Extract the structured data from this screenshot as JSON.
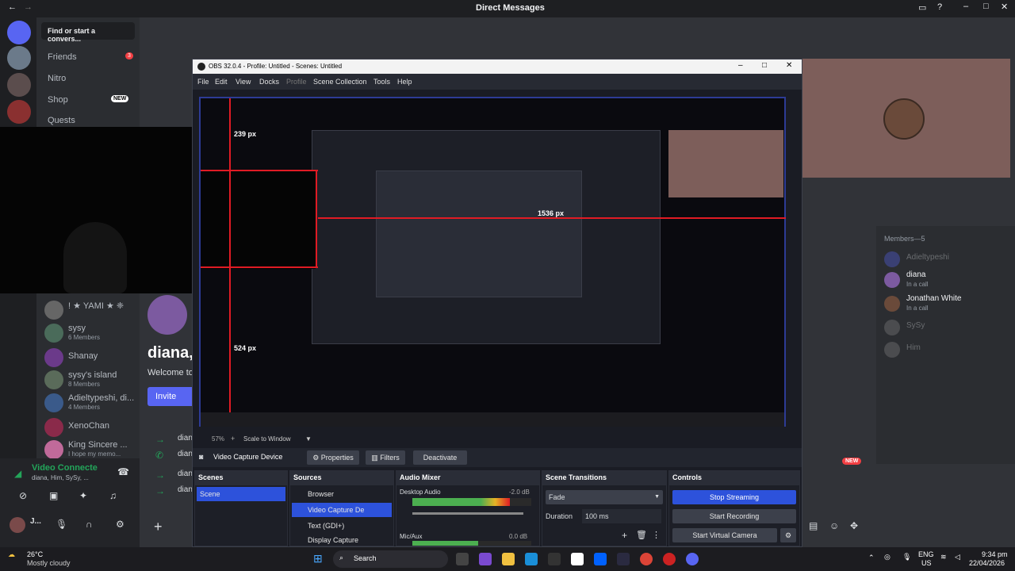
{
  "discord": {
    "title": "Direct Messages",
    "search_placeholder": "Find or start a convers...",
    "nav": [
      {
        "label": "Friends",
        "badge": "3"
      },
      {
        "label": "Nitro",
        "badge": ""
      },
      {
        "label": "Shop",
        "badge": "NEW"
      },
      {
        "label": "Quests",
        "badge": ""
      }
    ],
    "dms": [
      {
        "name": "! ★ YAMI ★ ❈",
        "sub": ""
      },
      {
        "name": "sysy",
        "sub": "6 Members"
      },
      {
        "name": "Shanay",
        "sub": ""
      },
      {
        "name": "sysy's island",
        "sub": "8 Members"
      },
      {
        "name": "Adieltypeshi, di...",
        "sub": "4 Members"
      },
      {
        "name": "XenoChan",
        "sub": ""
      },
      {
        "name": "King Sincere ...",
        "sub": "I hope my memo..."
      }
    ],
    "voice": {
      "label": "Video Connecte",
      "sub": "diana, Him, SySy, ..."
    },
    "user": "J...",
    "profile_name": "diana,",
    "welcome": "Welcome to",
    "invite": "Invite",
    "members_header": "Members—5",
    "members": [
      {
        "name": "Adieltypeshi",
        "status": ""
      },
      {
        "name": "diana",
        "status": "In a call"
      },
      {
        "name": "Jonathan White",
        "status": "In a call"
      },
      {
        "name": "SySy",
        "status": ""
      },
      {
        "name": "Him",
        "status": ""
      }
    ],
    "new_badge": "NEW",
    "chat_prefix": "dian"
  },
  "obs": {
    "title": "OBS 32.0.4 - Profile: Untitled - Scenes: Untitled",
    "menu": [
      "File",
      "Edit",
      "View",
      "Docks",
      "Profile",
      "Scene Collection",
      "Tools",
      "Help"
    ],
    "zoom": "57%",
    "scale": "Scale to Window",
    "source_name": "Video Capture Device",
    "properties": "Properties",
    "filters": "Filters",
    "deactivate": "Deactivate",
    "scenes": {
      "header": "Scenes",
      "items": [
        "Scene"
      ]
    },
    "sources": {
      "header": "Sources",
      "items": [
        "Browser",
        "Video Capture De",
        "Text (GDI+)",
        "Display Capture"
      ]
    },
    "mixer": {
      "header": "Audio Mixer",
      "tracks": [
        {
          "name": "Desktop Audio",
          "db": "-2.0 dB",
          "level": 0.82
        },
        {
          "name": "Mic/Aux",
          "db": "0.0 dB",
          "level": 0.55
        }
      ]
    },
    "transitions": {
      "header": "Scene Transitions",
      "type": "Fade",
      "duration_label": "Duration",
      "duration": "100 ms"
    },
    "controls": {
      "header": "Controls",
      "stop_streaming": "Stop Streaming",
      "start_recording": "Start Recording",
      "start_virtual": "Start Virtual Camera"
    },
    "measure_1": "239 px",
    "measure_2": "1536 px",
    "measure_3": "524 px"
  },
  "taskbar": {
    "temp": "26°C",
    "weather": "Mostly cloudy",
    "search": "Search",
    "lang": "ENG",
    "region": "US",
    "time": "9:34 pm",
    "date": "22/04/2026"
  },
  "colors": {
    "discord_bg": "#313338",
    "obs_blue": "#2d52db",
    "red_guide": "#e01b24",
    "mixer_green": "#4caf50"
  }
}
